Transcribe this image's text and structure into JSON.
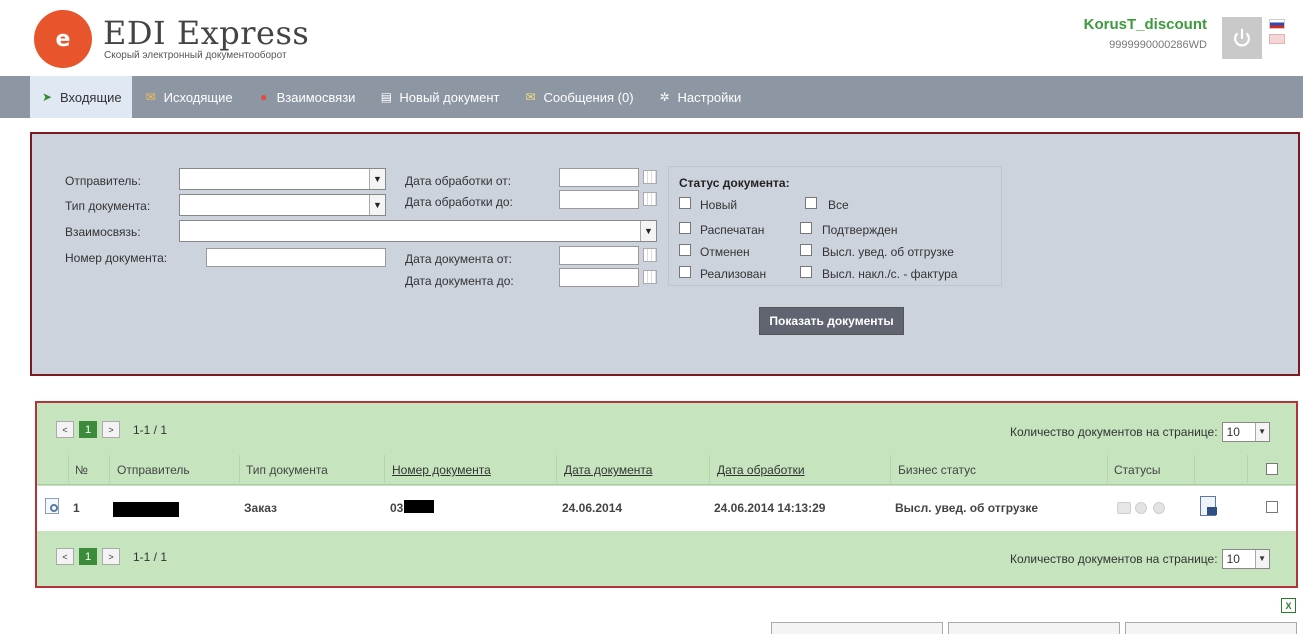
{
  "header": {
    "logo_mark": "e",
    "title": "EDI Express",
    "subtitle": "Скорый электронный документооборот",
    "user_name": "KorusT_discount",
    "user_id": "9999990000286WD"
  },
  "nav": {
    "items": [
      {
        "label": "Входящие",
        "icon": "inbox-icon",
        "active": true
      },
      {
        "label": "Исходящие",
        "icon": "outbox-icon"
      },
      {
        "label": "Взаимосвязи",
        "icon": "relations-icon"
      },
      {
        "label": "Новый документ",
        "icon": "new-document-icon"
      },
      {
        "label": "Сообщения (0)",
        "icon": "envelope-icon"
      },
      {
        "label": "Настройки",
        "icon": "gear-icon"
      }
    ]
  },
  "filter": {
    "sender_label": "Отправитель:",
    "doctype_label": "Тип документа:",
    "relation_label": "Взаимосвязь:",
    "docnum_label": "Номер документа:",
    "proc_from_label": "Дата обработки от:",
    "proc_to_label": "Дата обработки до:",
    "doc_from_label": "Дата документа от:",
    "doc_to_label": "Дата документа до:",
    "status_title": "Статус документа:",
    "statuses": {
      "new": "Новый",
      "all": "Все",
      "printed": "Распечатан",
      "confirmed": "Подтвержден",
      "cancelled": "Отменен",
      "ship_notice": "Высл. увед. об отгрузке",
      "realized": "Реализован",
      "invoice": "Высл. накл./с. - фактура"
    },
    "show_button": "Показать документы"
  },
  "results": {
    "pager": {
      "current_page": "1",
      "range": "1-1 / 1",
      "prev": "<",
      "next": ">"
    },
    "per_page_label": "Количество документов на странице:",
    "per_page_value": "10",
    "columns": {
      "num": "№",
      "sender": "Отправитель",
      "doctype": "Тип документа",
      "docnum": "Номер документа",
      "docdate": "Дата документа",
      "procdate": "Дата обработки",
      "bizstatus": "Бизнес статус",
      "statuses": "Статусы"
    },
    "rows": [
      {
        "num": "1",
        "doctype": "Заказ",
        "docnum_prefix": "03",
        "docdate": "24.06.2014",
        "procdate": "24.06.2014 14:13:29",
        "bizstatus": "Высл. увед. об отгрузке"
      }
    ]
  },
  "colors": {
    "nav_bg": "#8d97a4",
    "filter_bg": "#cdd3dd",
    "filter_border": "#7b1a22",
    "results_bg": "#c6e5bf",
    "results_border": "#b1343a",
    "accent_green": "#3d9a3d",
    "logo_orange": "#e8542b"
  }
}
